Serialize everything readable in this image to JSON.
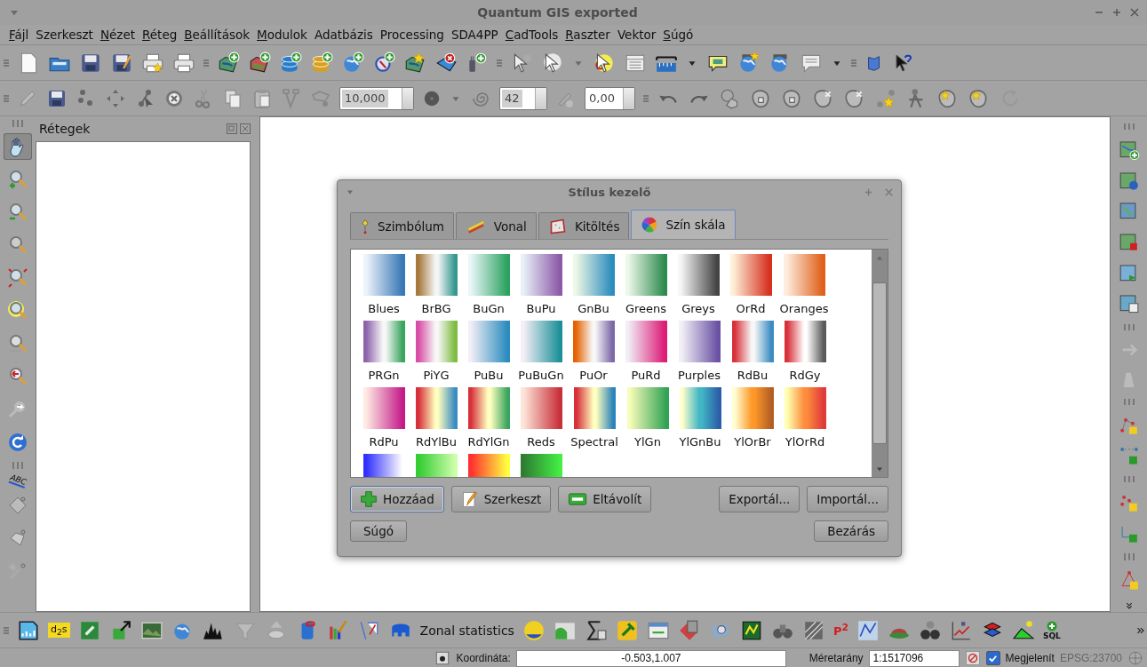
{
  "window": {
    "title": "Quantum GIS exported"
  },
  "menu": [
    {
      "label": "Fájl",
      "mnemonic": true
    },
    {
      "label": "Szerkeszt",
      "mnemonic": false
    },
    {
      "label": "Nézet",
      "mnemonic": true
    },
    {
      "label": "Réteg",
      "mnemonic": true
    },
    {
      "label": "Beállítások",
      "mnemonic": true
    },
    {
      "label": "Modulok",
      "mnemonic": true
    },
    {
      "label": "Adatbázis",
      "mnemonic": false
    },
    {
      "label": "Processing",
      "mnemonic": false
    },
    {
      "label": "SDA4PP",
      "mnemonic": false
    },
    {
      "label": "CadTools",
      "mnemonic": true
    },
    {
      "label": "Raszter",
      "mnemonic": true
    },
    {
      "label": "Vektor",
      "mnemonic": false
    },
    {
      "label": "Súgó",
      "mnemonic": true
    }
  ],
  "digitize_toolbar": {
    "fields": [
      {
        "value": "10,000"
      },
      {
        "value": "42"
      },
      {
        "value": "0,00"
      }
    ]
  },
  "left_toolbar": {
    "tools": [
      {
        "selected": true
      },
      {
        "selected": false
      },
      {
        "selected": false
      },
      {
        "selected": false
      },
      {
        "selected": false
      },
      {
        "selected": false
      },
      {
        "selected": false
      },
      {
        "selected": false
      },
      {
        "selected": false
      },
      {
        "selected": false
      }
    ],
    "label_icon_text": "ABC"
  },
  "layers_panel": {
    "title": "Rétegek"
  },
  "dialog": {
    "title": "Stílus kezelő",
    "tabs": [
      {
        "label": "Szimbólum",
        "selected": false
      },
      {
        "label": "Vonal",
        "selected": false
      },
      {
        "label": "Kitöltés",
        "selected": false
      },
      {
        "label": "Szín skála",
        "selected": true
      }
    ],
    "ramps": [
      {
        "name": "Blues",
        "stops": [
          {
            "color": "#eef4fb"
          },
          {
            "color": "#3a78b6"
          }
        ]
      },
      {
        "name": "BrBG",
        "stops": [
          {
            "color": "#a6793d"
          },
          {
            "color": "#f5f5f5"
          },
          {
            "color": "#35978f"
          }
        ]
      },
      {
        "name": "BuGn",
        "stops": [
          {
            "color": "#e8f6f8"
          },
          {
            "color": "#2ca25f"
          }
        ]
      },
      {
        "name": "BuPu",
        "stops": [
          {
            "color": "#e8f0f8"
          },
          {
            "color": "#8c5aa8"
          }
        ]
      },
      {
        "name": "GnBu",
        "stops": [
          {
            "color": "#eef8e6"
          },
          {
            "color": "#2b8cbe"
          }
        ]
      },
      {
        "name": "Greens",
        "stops": [
          {
            "color": "#edf8e9"
          },
          {
            "color": "#2e8b4e"
          }
        ]
      },
      {
        "name": "Greys",
        "stops": [
          {
            "color": "#f7f7f7"
          },
          {
            "color": "#444444"
          }
        ]
      },
      {
        "name": "OrRd",
        "stops": [
          {
            "color": "#fef0d9"
          },
          {
            "color": "#d7301f"
          }
        ]
      },
      {
        "name": "Oranges",
        "stops": [
          {
            "color": "#feedde"
          },
          {
            "color": "#e0601a"
          }
        ]
      },
      {
        "name": "PRGn",
        "stops": [
          {
            "color": "#8c62aa"
          },
          {
            "color": "#f7f7f7"
          },
          {
            "color": "#3aa55e"
          }
        ]
      },
      {
        "name": "PiYG",
        "stops": [
          {
            "color": "#d74fa5"
          },
          {
            "color": "#f7f7f7"
          },
          {
            "color": "#7fbc41"
          }
        ]
      },
      {
        "name": "PuBu",
        "stops": [
          {
            "color": "#f1eef6"
          },
          {
            "color": "#2b8cbe"
          }
        ]
      },
      {
        "name": "PuBuGn",
        "stops": [
          {
            "color": "#f6eff7"
          },
          {
            "color": "#1c9099"
          }
        ]
      },
      {
        "name": "PuOr",
        "stops": [
          {
            "color": "#e66101"
          },
          {
            "color": "#f7f7f7"
          },
          {
            "color": "#7d68a8"
          }
        ]
      },
      {
        "name": "PuRd",
        "stops": [
          {
            "color": "#f1eef6"
          },
          {
            "color": "#dd1c77"
          }
        ]
      },
      {
        "name": "Purples",
        "stops": [
          {
            "color": "#f2f0f7"
          },
          {
            "color": "#6a51a3"
          }
        ]
      },
      {
        "name": "RdBu",
        "stops": [
          {
            "color": "#d7303a"
          },
          {
            "color": "#f7f7f7"
          },
          {
            "color": "#3b8cc2"
          }
        ]
      },
      {
        "name": "RdGy",
        "stops": [
          {
            "color": "#d7303a"
          },
          {
            "color": "#ffffff"
          },
          {
            "color": "#5a5a5a"
          }
        ]
      },
      {
        "name": "RdPu",
        "stops": [
          {
            "color": "#feebe2"
          },
          {
            "color": "#c51b8a"
          }
        ]
      },
      {
        "name": "RdYlBu",
        "stops": [
          {
            "color": "#d7303a"
          },
          {
            "color": "#ffffbf"
          },
          {
            "color": "#3b8cc2"
          }
        ]
      },
      {
        "name": "RdYlGn",
        "stops": [
          {
            "color": "#d7303a"
          },
          {
            "color": "#ffffbf"
          },
          {
            "color": "#3aa55e"
          }
        ]
      },
      {
        "name": "Reds",
        "stops": [
          {
            "color": "#fee5d9"
          },
          {
            "color": "#c8303a"
          }
        ]
      },
      {
        "name": "Spectral",
        "stops": [
          {
            "color": "#d7303a"
          },
          {
            "color": "#ffffbf"
          },
          {
            "color": "#2b83ba"
          }
        ]
      },
      {
        "name": "YlGn",
        "stops": [
          {
            "color": "#f7fcb9"
          },
          {
            "color": "#31a354"
          }
        ]
      },
      {
        "name": "YlGnBu",
        "stops": [
          {
            "color": "#ffffcc"
          },
          {
            "color": "#41b6c4"
          },
          {
            "color": "#2c5fa8"
          }
        ]
      },
      {
        "name": "YlOrBr",
        "stops": [
          {
            "color": "#ffffd4"
          },
          {
            "color": "#fe9929"
          },
          {
            "color": "#b35e25"
          }
        ]
      },
      {
        "name": "YlOrRd",
        "stops": [
          {
            "color": "#ffffb2"
          },
          {
            "color": "#fd8d3c"
          },
          {
            "color": "#e03a3a"
          }
        ]
      },
      {
        "stops": [
          {
            "color": "#3030ff"
          },
          {
            "color": "#ffffff"
          }
        ]
      },
      {
        "stops": [
          {
            "color": "#33cc33"
          },
          {
            "color": "#ccffaa"
          }
        ]
      },
      {
        "stops": [
          {
            "color": "#ff3030"
          },
          {
            "color": "#ffff40"
          }
        ]
      },
      {
        "stops": [
          {
            "color": "#2e7d32"
          },
          {
            "color": "#44ee44"
          }
        ]
      }
    ],
    "buttons": [
      {
        "label": "Hozzáad",
        "kind": "add",
        "focused": true
      },
      {
        "label": "Szerkeszt",
        "kind": "edit",
        "focused": false
      },
      {
        "label": "Eltávolít",
        "kind": "remove",
        "focused": false
      },
      {
        "label": "Exportál...",
        "kind": "plain",
        "focused": false
      },
      {
        "label": "Importál...",
        "kind": "plain",
        "focused": false
      }
    ],
    "help_button": "Súgó",
    "close_button": "Bezárás"
  },
  "plugin_toolbar": {
    "d2s_text": "d$_{2}$s",
    "zonal_label": "Zonal statistics",
    "p2_text": "P$^{2}$",
    "sql_text": "SQL"
  },
  "status_bar": {
    "coordinate_label": "Koordináta:",
    "coordinate_value": "-0.503,1.007",
    "scale_label": "Méretarány",
    "scale_value": "1:1517096",
    "render": {
      "label": "Megjelenít",
      "checked": true
    },
    "crs": "EPSG:23700"
  }
}
